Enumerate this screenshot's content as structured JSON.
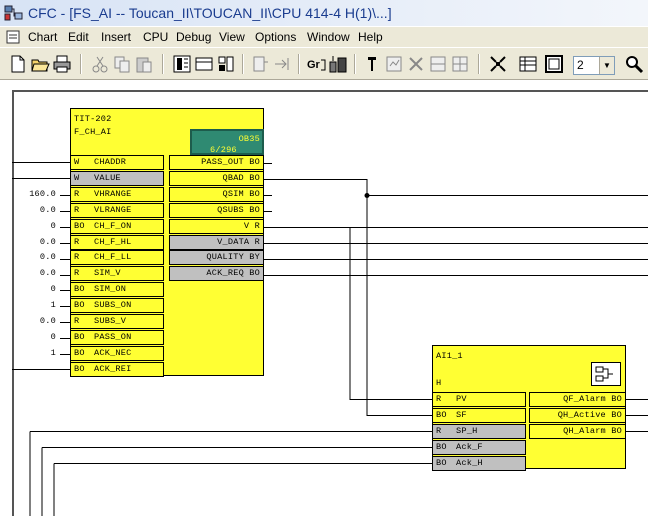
{
  "window": {
    "title": "CFC - [FS_AI -- Toucan_II\\TOUCAN_II\\CPU 414-4 H(1)\\...]",
    "app_icon": "cfc-app-icon"
  },
  "menu": [
    "Chart",
    "Edit",
    "Insert",
    "CPU",
    "Debug",
    "View",
    "Options",
    "Window",
    "Help"
  ],
  "toolbar": {
    "icons": [
      "new-icon",
      "open-icon",
      "print-icon",
      "cut-icon",
      "copy-icon",
      "paste-icon",
      "block-view-icon",
      "sheet-icon",
      "overview-icon",
      "insert-block-icon",
      "goto-icon",
      "compile-icon",
      "download-icon",
      "test-icon",
      "watch-icon",
      "delete-icon",
      "align-icon",
      "grid-icon",
      "table-icon",
      "sheet-view-icon",
      "zoom-icon"
    ],
    "zoom_value": "2"
  },
  "blocks": {
    "tit202": {
      "name": "TIT-202",
      "type": "F_CH_AI",
      "ob_label": "OB35",
      "ob_sub": "6/296",
      "inputs": [
        {
          "prefix": "W",
          "name": "CHADDR",
          "const": ""
        },
        {
          "prefix": "W",
          "name": "VALUE",
          "const": ""
        },
        {
          "prefix": "R",
          "name": "VHRANGE",
          "const": "160.0"
        },
        {
          "prefix": "R",
          "name": "VLRANGE",
          "const": "0.0"
        },
        {
          "prefix": "BO",
          "name": "CH_F_ON",
          "const": "0"
        },
        {
          "prefix": "R",
          "name": "CH_F_HL",
          "const": "0.0"
        },
        {
          "prefix": "R",
          "name": "CH_F_LL",
          "const": "0.0"
        },
        {
          "prefix": "R",
          "name": "SIM_V",
          "const": "0.0"
        },
        {
          "prefix": "BO",
          "name": "SIM_ON",
          "const": "0"
        },
        {
          "prefix": "BO",
          "name": "SUBS_ON",
          "const": "1"
        },
        {
          "prefix": "R",
          "name": "SUBS_V",
          "const": "0.0"
        },
        {
          "prefix": "BO",
          "name": "PASS_ON",
          "const": "0"
        },
        {
          "prefix": "BO",
          "name": "ACK_NEC",
          "const": "1"
        },
        {
          "prefix": "BO",
          "name": "ACK_REI",
          "const": ""
        }
      ],
      "outputs": [
        {
          "name": "PASS_OUT",
          "type": "BO"
        },
        {
          "name": "QBAD",
          "type": "BO"
        },
        {
          "name": "QSIM",
          "type": "BO"
        },
        {
          "name": "QSUBS",
          "type": "BO"
        },
        {
          "name": "V",
          "type": "R"
        },
        {
          "name": "V_DATA",
          "type": "R"
        },
        {
          "name": "QUALITY",
          "type": "BY"
        },
        {
          "name": "ACK_REQ",
          "type": "BO"
        }
      ]
    },
    "ai1": {
      "name": "AI1_1",
      "type": "H",
      "inputs": [
        {
          "prefix": "R",
          "name": "PV"
        },
        {
          "prefix": "BO",
          "name": "SF"
        },
        {
          "prefix": "R",
          "name": "SP_H"
        },
        {
          "prefix": "BO",
          "name": "Ack_F"
        },
        {
          "prefix": "BO",
          "name": "Ack_H"
        }
      ],
      "outputs": [
        {
          "name": "QF_Alarm",
          "type": "BO"
        },
        {
          "name": "QH_Active",
          "type": "BO"
        },
        {
          "name": "QH_Alarm",
          "type": "BO"
        }
      ]
    }
  }
}
